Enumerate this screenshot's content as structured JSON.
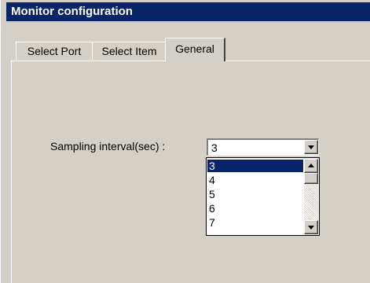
{
  "window": {
    "title": "Monitor configuration"
  },
  "tabs": [
    {
      "label": "Select Port"
    },
    {
      "label": "Select Item"
    },
    {
      "label": "General"
    }
  ],
  "general": {
    "sampling_label": "Sampling interval(sec) :",
    "sampling_value": "3",
    "options": [
      "3",
      "4",
      "5",
      "6",
      "7"
    ],
    "selected_option": "3"
  }
}
